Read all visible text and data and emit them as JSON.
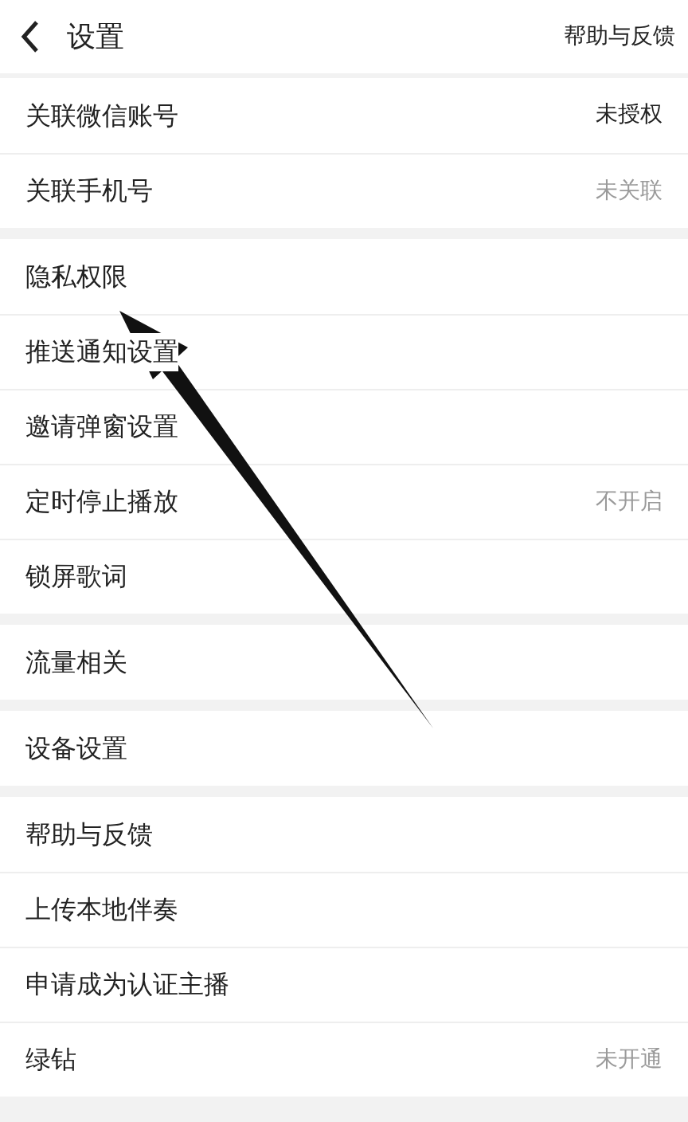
{
  "header": {
    "title": "设置",
    "action": "帮助与反馈"
  },
  "groups": [
    {
      "items": [
        {
          "label": "关联微信账号",
          "value": "未授权",
          "dimmed": false
        },
        {
          "label": "关联手机号",
          "value": "未关联",
          "dimmed": true
        }
      ]
    },
    {
      "items": [
        {
          "label": "隐私权限"
        },
        {
          "label": "推送通知设置"
        },
        {
          "label": "邀请弹窗设置"
        },
        {
          "label": "定时停止播放",
          "value": "不开启",
          "dimmed": true
        },
        {
          "label": "锁屏歌词"
        }
      ]
    },
    {
      "items": [
        {
          "label": "流量相关"
        }
      ]
    },
    {
      "items": [
        {
          "label": "设备设置"
        }
      ]
    },
    {
      "items": [
        {
          "label": "帮助与反馈"
        },
        {
          "label": "上传本地伴奏"
        },
        {
          "label": "申请成为认证主播"
        },
        {
          "label": "绿钻",
          "value": "未开通",
          "dimmed": true
        }
      ]
    }
  ]
}
